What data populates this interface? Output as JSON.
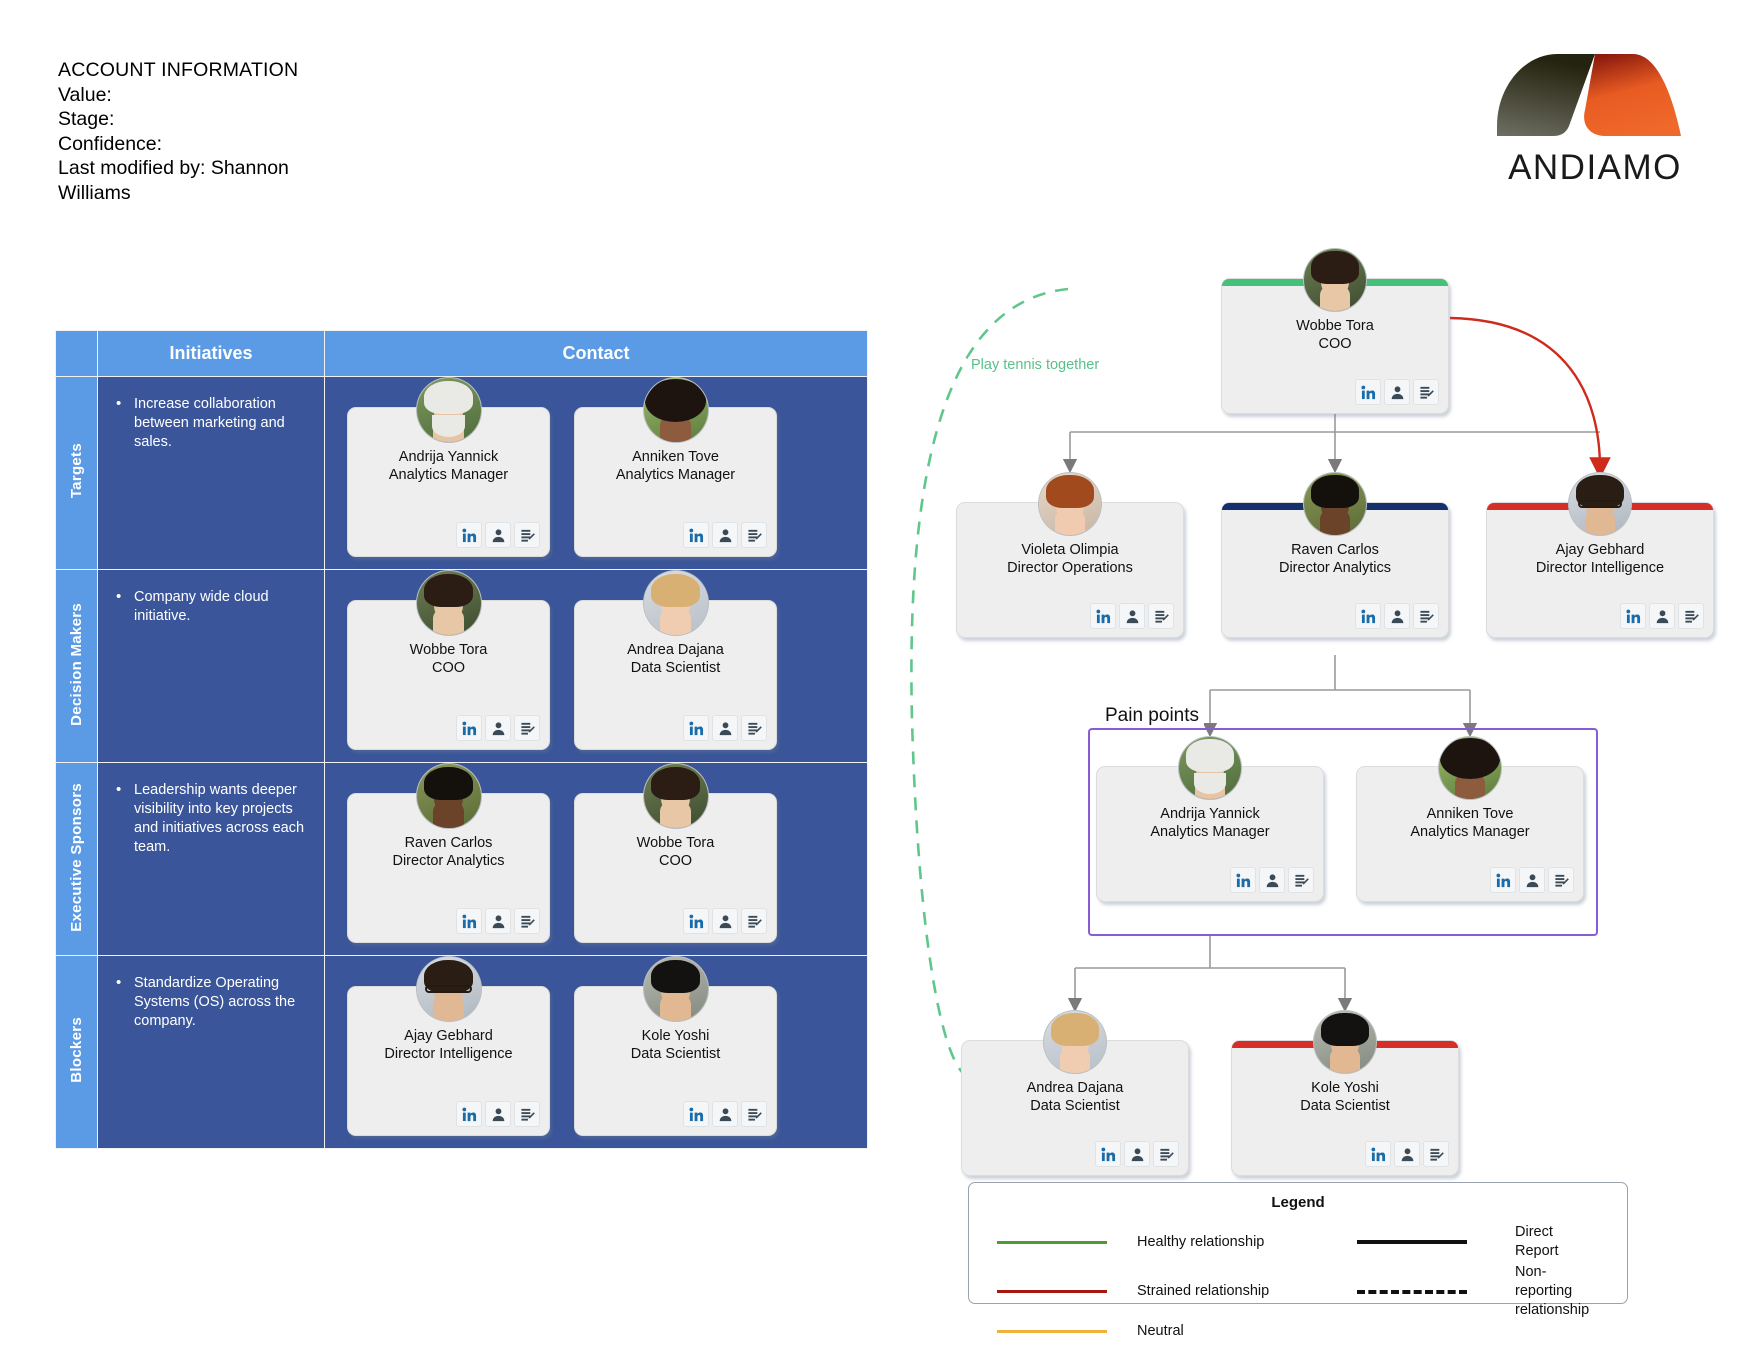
{
  "account": {
    "title": "ACCOUNT INFORMATION",
    "value_label": "Value:",
    "stage_label": "Stage:",
    "confidence_label": "Confidence:",
    "last_modified": "Last modified by: Shannon Williams"
  },
  "brand": {
    "name": "ANDIAMO",
    "dark": "#3d3c33",
    "orange": "#ea5b20"
  },
  "table": {
    "headers": [
      "",
      "Initiatives",
      "Contact"
    ],
    "header_bg": "#5b9be5",
    "body_bg": "#3a5599",
    "rows": [
      {
        "label": "Targets",
        "initiative": "Increase collaboration between marketing and sales.",
        "contacts": [
          {
            "name": "Andrija Yannick",
            "title": "Analytics Manager",
            "avatar": "older-man-beard"
          },
          {
            "name": "Anniken Tove",
            "title": "Analytics Manager",
            "avatar": "woman-curly-hair"
          }
        ]
      },
      {
        "label": "Decision Makers",
        "initiative": "Company wide cloud initiative.",
        "contacts": [
          {
            "name": "Wobbe Tora",
            "title": "COO",
            "avatar": "woman-dark-hair"
          },
          {
            "name": "Andrea Dajana",
            "title": "Data Scientist",
            "avatar": "woman-blonde"
          }
        ]
      },
      {
        "label": "Executive Sponsors",
        "initiative": "Leadership wants deeper visibility into key projects and initiatives across each team.",
        "contacts": [
          {
            "name": "Raven Carlos",
            "title": "Director Analytics",
            "avatar": "man-dark-skin"
          },
          {
            "name": "Wobbe Tora",
            "title": "COO",
            "avatar": "woman-dark-hair"
          }
        ]
      },
      {
        "label": "Blockers",
        "initiative": "Standardize Operating Systems (OS) across the company.",
        "contacts": [
          {
            "name": "Ajay Gebhard",
            "title": "Director Intelligence",
            "avatar": "man-glasses-suit"
          },
          {
            "name": "Kole Yoshi",
            "title": "Data Scientist",
            "avatar": "man-black-hair"
          }
        ]
      }
    ]
  },
  "card_icons": [
    {
      "name": "linkedin-icon",
      "label": "in"
    },
    {
      "name": "contact-person-icon",
      "label": "person"
    },
    {
      "name": "notes-edit-icon",
      "label": "notes"
    }
  ],
  "org_chart": {
    "group_label": "Pain points",
    "group_border_color": "#8a5bd6",
    "relationship_label": "Play tennis together",
    "nodes": [
      {
        "id": "wobbe",
        "name": "Wobbe Tora",
        "title": "COO",
        "status_color": "#45c07a",
        "avatar": "woman-dark-hair"
      },
      {
        "id": "violeta",
        "name": "Violeta Olimpia",
        "title": "Director Operations",
        "status_color": "",
        "avatar": "woman-red-hair"
      },
      {
        "id": "raven",
        "name": "Raven Carlos",
        "title": "Director Analytics",
        "status_color": "#15306b",
        "avatar": "man-dark-skin"
      },
      {
        "id": "ajay",
        "name": "Ajay Gebhard",
        "title": "Director Intelligence",
        "status_color": "#d62f2a",
        "avatar": "man-glasses-suit"
      },
      {
        "id": "andrija",
        "name": "Andrija Yannick",
        "title": "Analytics Manager",
        "status_color": "",
        "avatar": "older-man-beard"
      },
      {
        "id": "anniken",
        "name": "Anniken Tove",
        "title": "Analytics Manager",
        "status_color": "",
        "avatar": "woman-curly-hair"
      },
      {
        "id": "andrea",
        "name": "Andrea Dajana",
        "title": "Data Scientist",
        "status_color": "",
        "avatar": "woman-blonde"
      },
      {
        "id": "kole",
        "name": "Kole Yoshi",
        "title": "Data Scientist",
        "status_color": "#d62f2a",
        "avatar": "man-black-hair"
      }
    ]
  },
  "legend": {
    "title": "Legend",
    "items_left": [
      {
        "label": "Healthy relationship",
        "color": "#4e9b36"
      },
      {
        "label": "Strained relationship",
        "color": "#a81610"
      },
      {
        "label": "Neutral",
        "color": "#f0b13a"
      }
    ],
    "items_right": [
      {
        "label": "Direct Report",
        "style": "solid",
        "color": "#111111"
      },
      {
        "label": "Non-reporting relationship",
        "style": "dashed",
        "color": "#111111"
      }
    ]
  }
}
